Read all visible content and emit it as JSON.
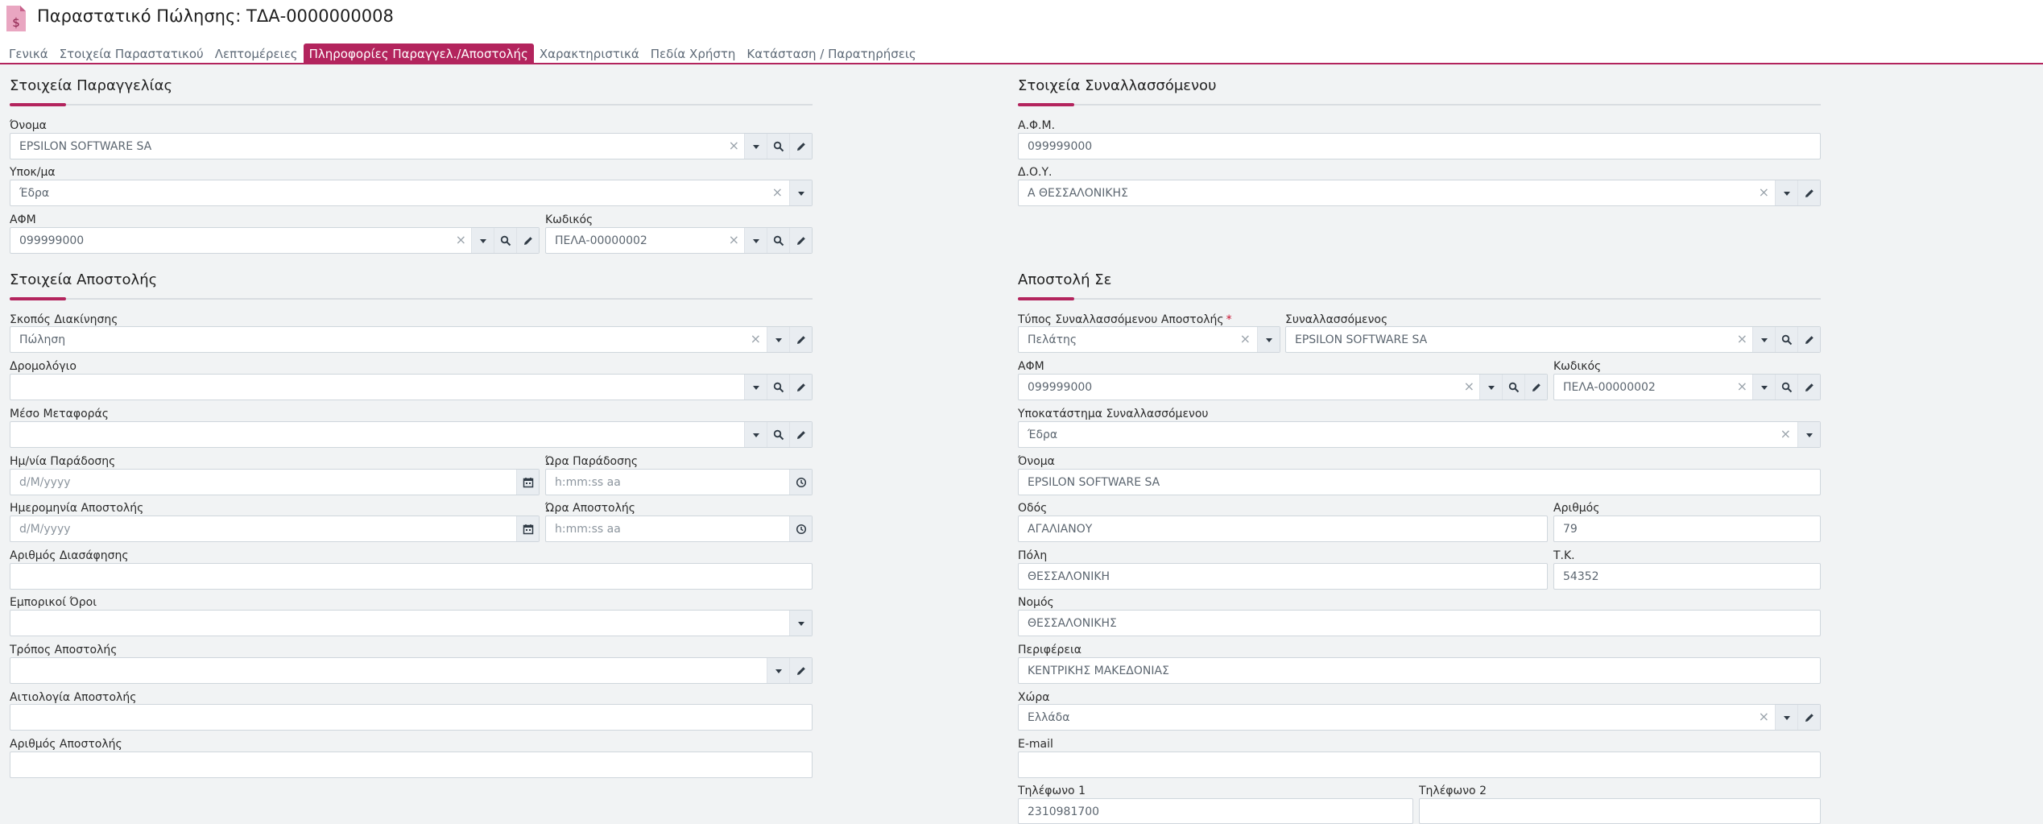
{
  "header": {
    "title": "Παραστατικό Πώλησης: ΤΔΑ-0000000008",
    "tabs": [
      "Γενικά",
      "Στοιχεία Παραστατικού",
      "Λεπτομέρειες",
      "Πληροφορίες Παραγγελ./Αποστολής",
      "Χαρακτηριστικά",
      "Πεδία Χρήστη",
      "Κατάσταση / Παρατηρήσεις"
    ],
    "active_tab": 3
  },
  "order": {
    "title": "Στοιχεία Παραγγελίας",
    "name_label": "Όνομα",
    "name_value": "EPSILON SOFTWARE SA",
    "branch_label": "Υποκ/μα",
    "branch_value": "Έδρα",
    "afm_label": "ΑΦΜ",
    "afm_value": "099999000",
    "code_label": "Κωδικός",
    "code_value": "ΠΕΛΑ-00000002"
  },
  "party": {
    "title": "Στοιχεία Συναλλασσόμενου",
    "afm_label": "Α.Φ.Μ.",
    "afm_value": "099999000",
    "doy_label": "Δ.Ο.Υ.",
    "doy_value": "Α ΘΕΣΣΑΛΟΝΙΚΗΣ"
  },
  "shipping": {
    "title": "Στοιχεία Αποστολής",
    "purpose_label": "Σκοπός Διακίνησης",
    "purpose_value": "Πώληση",
    "route_label": "Δρομολόγιο",
    "transport_label": "Μέσο Μεταφοράς",
    "delivery_date_label": "Ημ/νία Παράδοσης",
    "delivery_date_ph": "d/M/yyyy",
    "delivery_time_label": "Ώρα Παράδοσης",
    "delivery_time_ph": "h:mm:ss aa",
    "ship_date_label": "Ημερομηνία Αποστολής",
    "ship_date_ph": "d/M/yyyy",
    "ship_time_label": "Ώρα Αποστολής",
    "ship_time_ph": "h:mm:ss aa",
    "clearance_label": "Αριθμός Διασάφησης",
    "terms_label": "Εμπορικοί Όροι",
    "method_label": "Τρόπος Αποστολής",
    "reason_label": "Αιτιολογία Αποστολής",
    "number_label": "Αριθμός Αποστολής"
  },
  "ship_to": {
    "title": "Αποστολή Σε",
    "type_label": "Τύπος Συναλλασσόμενου Αποστολής",
    "type_required": "*",
    "type_value": "Πελάτης",
    "party_label": "Συναλλασσόμενος",
    "party_value": "EPSILON SOFTWARE SA",
    "afm_label": "ΑΦΜ",
    "afm_value": "099999000",
    "code_label": "Κωδικός",
    "code_value": "ΠΕΛΑ-00000002",
    "branch_label": "Υποκατάστημα Συναλλασσόμενου",
    "branch_value": "Έδρα",
    "name_label": "Όνομα",
    "name_value": "EPSILON SOFTWARE SA",
    "street_label": "Οδός",
    "street_value": "ΑΓΑΛΙΑΝΟΥ",
    "number_label": "Αριθμός",
    "number_value": "79",
    "city_label": "Πόλη",
    "city_value": "ΘΕΣΣΑΛΟΝΙΚΗ",
    "zip_label": "Τ.Κ.",
    "zip_value": "54352",
    "prefecture_label": "Νομός",
    "prefecture_value": "ΘΕΣΣΑΛΟΝΙΚΗΣ",
    "region_label": "Περιφέρεια",
    "region_value": "ΚΕΝΤΡΙΚΗΣ ΜΑΚΕΔΟΝΙΑΣ",
    "country_label": "Χώρα",
    "country_value": "Ελλάδα",
    "email_label": "E-mail",
    "phone1_label": "Τηλέφωνο 1",
    "phone1_value": "2310981700",
    "phone2_label": "Τηλέφωνο 2"
  },
  "icons": {
    "clear": "×",
    "accent_color": "#b3245d"
  }
}
